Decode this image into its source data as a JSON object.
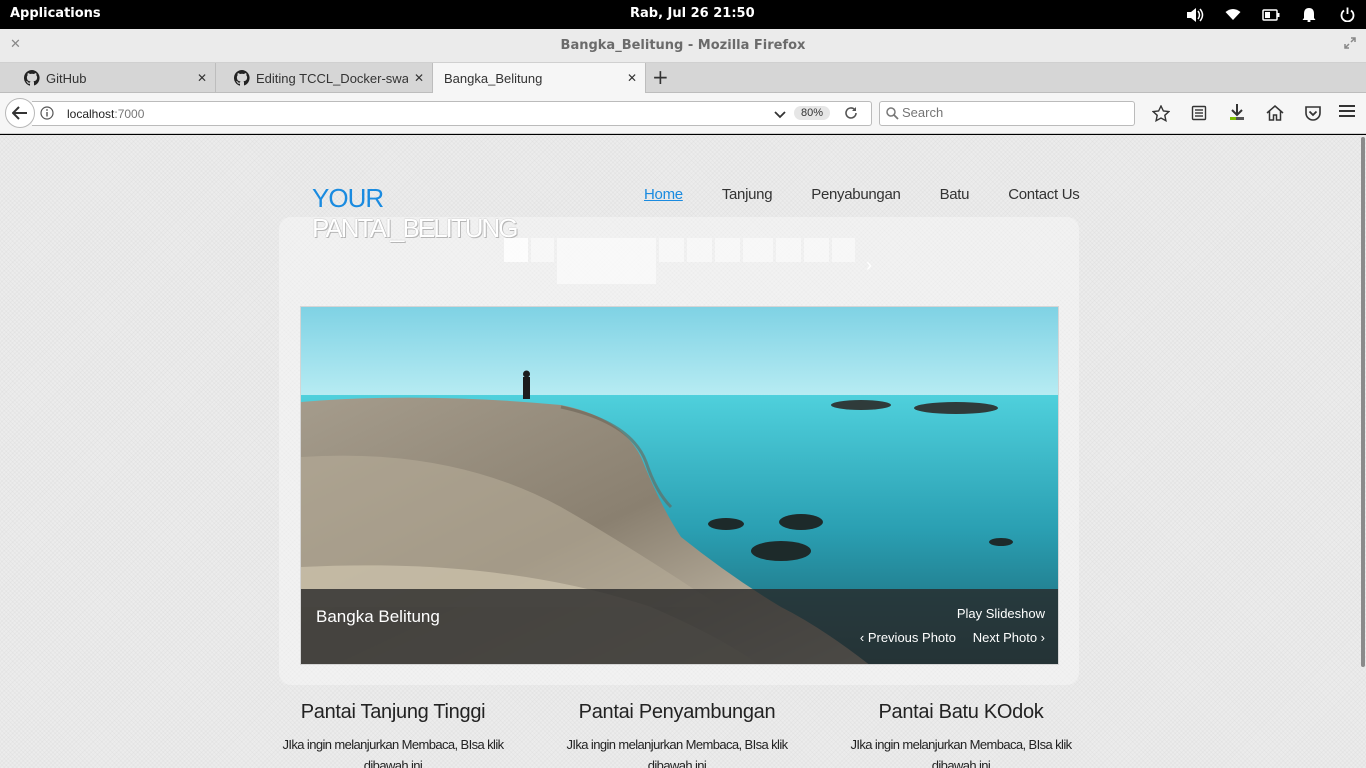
{
  "system": {
    "applications": "Applications",
    "clock": "Rab, Jul 26   21:50"
  },
  "window": {
    "title": "Bangka_Belitung - Mozilla Firefox"
  },
  "tabs": [
    {
      "label": "GitHub"
    },
    {
      "label": "Editing TCCL_Docker-swarm"
    },
    {
      "label": "Bangka_Belitung"
    }
  ],
  "urlbar": {
    "host": "localhost",
    "port": ":7000",
    "zoom": "80%"
  },
  "search": {
    "placeholder": "Search"
  },
  "site": {
    "logo_line1": "YOUR",
    "logo_line2": "PANTAI_BELITUNG",
    "nav": [
      "Home",
      "Tanjung",
      "Penyabungan",
      "Batu",
      "Contact Us"
    ]
  },
  "slideshow": {
    "caption": "Bangka Belitung",
    "play": "Play Slideshow",
    "prev": "‹ Previous Photo",
    "next": "Next Photo ›"
  },
  "columns": [
    {
      "title": "Pantai Tanjung Tinggi",
      "text": "JIka ingin melanjurkan Membaca, BIsa klik dibawah ini"
    },
    {
      "title": "Pantai Penyambungan",
      "text": "JIka ingin melanjurkan Membaca, BIsa klik dibawah ini"
    },
    {
      "title": "Pantai Batu KOdok",
      "text": "JIka ingin melanjurkan Membaca, BIsa klik dibawah ini"
    }
  ],
  "colors": {
    "accent": "#1a8be0",
    "topbar": "#000000"
  }
}
